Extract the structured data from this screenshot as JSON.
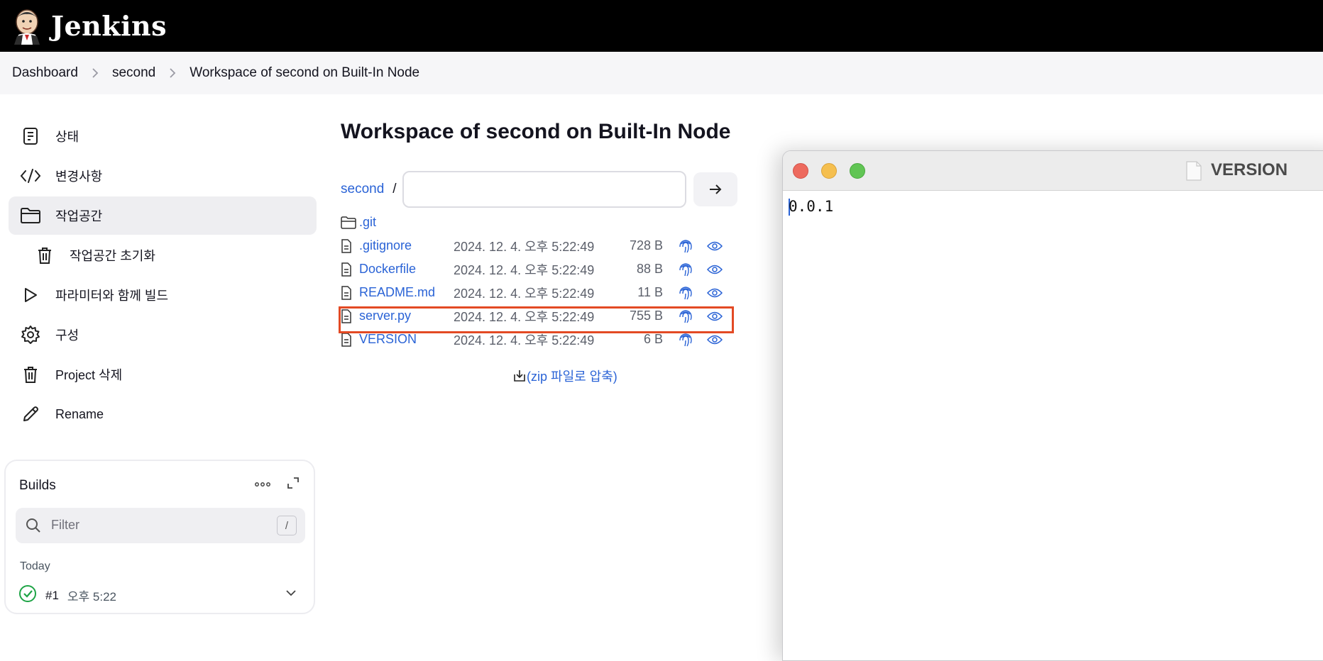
{
  "app": {
    "brand": "Jenkins"
  },
  "breadcrumbs": [
    "Dashboard",
    "second",
    "Workspace of second on Built-In Node"
  ],
  "sidebar": {
    "items": [
      {
        "label": "상태",
        "icon": "status-icon"
      },
      {
        "label": "변경사항",
        "icon": "code-icon"
      },
      {
        "label": "작업공간",
        "icon": "folder-icon",
        "active": true
      },
      {
        "label": "작업공간 초기화",
        "icon": "trash-icon",
        "sub": true
      },
      {
        "label": "파라미터와 함께 빌드",
        "icon": "play-icon"
      },
      {
        "label": "구성",
        "icon": "gear-icon"
      },
      {
        "label": "Project 삭제",
        "icon": "trash-icon"
      },
      {
        "label": "Rename",
        "icon": "pencil-icon"
      }
    ]
  },
  "builds": {
    "title": "Builds",
    "filter_placeholder": "Filter",
    "filter_shortcut": "/",
    "group": "Today",
    "runs": [
      {
        "number": "#1",
        "time": "오후 5:22",
        "status": "success"
      }
    ]
  },
  "main": {
    "title": "Workspace of second on Built-In Node",
    "path_root": "second",
    "path_sep": "/",
    "path_input": "",
    "files": [
      {
        "name": ".git",
        "type": "folder",
        "date": "",
        "size": ""
      },
      {
        "name": ".gitignore",
        "type": "file",
        "date": "2024. 12. 4. 오후 5:22:49",
        "size": "728 B"
      },
      {
        "name": "Dockerfile",
        "type": "file",
        "date": "2024. 12. 4. 오후 5:22:49",
        "size": "88 B"
      },
      {
        "name": "README.md",
        "type": "file",
        "date": "2024. 12. 4. 오후 5:22:49",
        "size": "11 B"
      },
      {
        "name": "server.py",
        "type": "file",
        "date": "2024. 12. 4. 오후 5:22:49",
        "size": "755 B"
      },
      {
        "name": "VERSION",
        "type": "file",
        "date": "2024. 12. 4. 오후 5:22:49",
        "size": "6 B",
        "highlighted": true
      }
    ],
    "zip_label": "(zip 파일로 압축)"
  },
  "editor": {
    "title": "VERSION",
    "content": "0.0.1"
  },
  "colors": {
    "link": "#2a63d6",
    "highlight": "#e34a24",
    "header": "#000000"
  }
}
